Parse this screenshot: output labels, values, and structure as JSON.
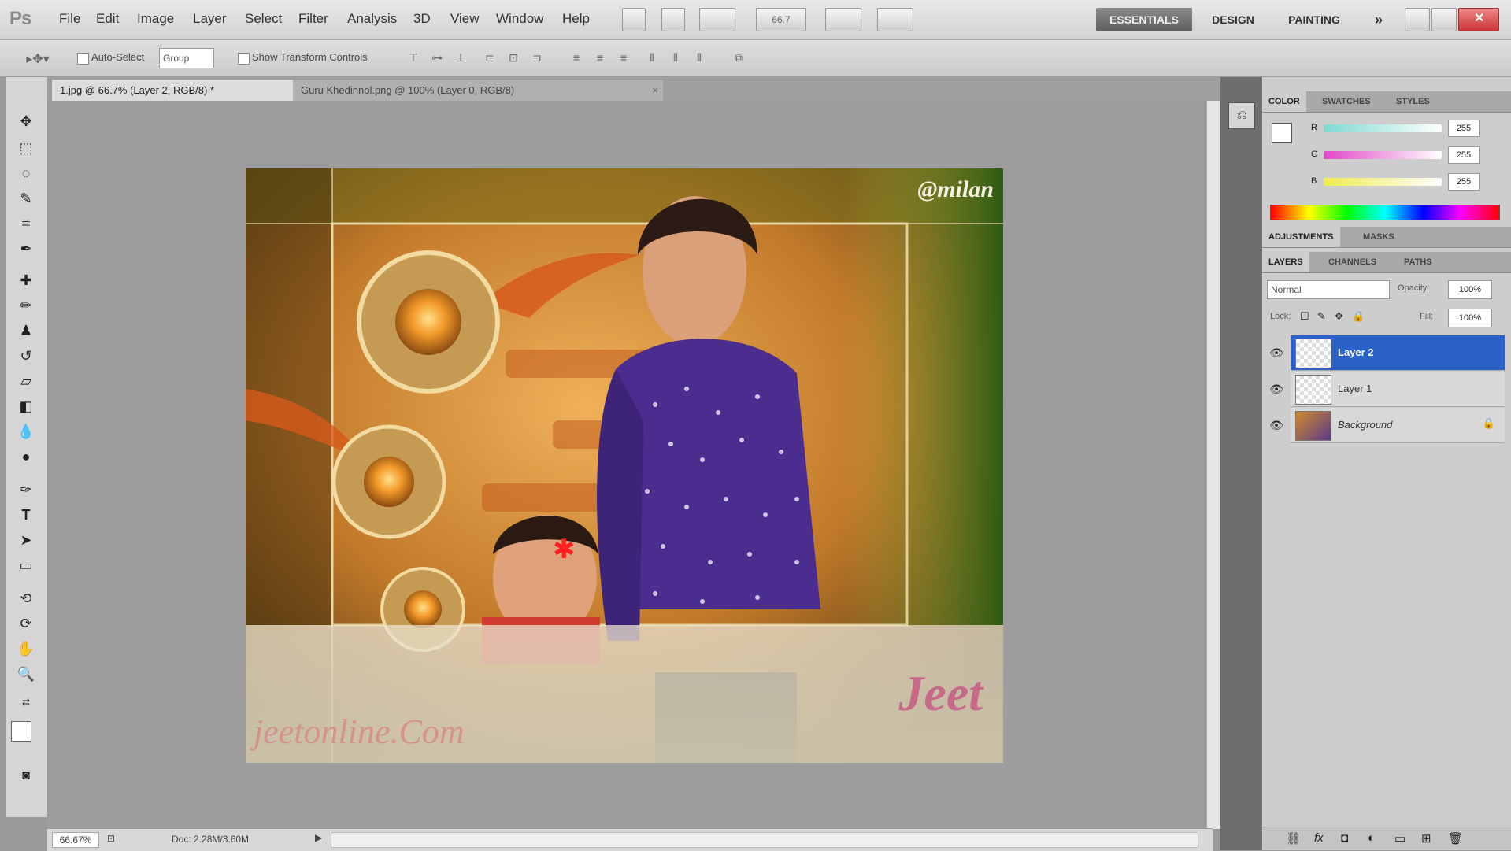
{
  "app": {
    "logo": "Ps",
    "menu": [
      "File",
      "Edit",
      "Image",
      "Layer",
      "Select",
      "Filter",
      "Analysis",
      "3D",
      "View",
      "Window",
      "Help"
    ],
    "zoom_field": "66.7",
    "workspaces": [
      "ESSENTIALS",
      "DESIGN",
      "PAINTING"
    ],
    "more_workspaces": "»"
  },
  "options": {
    "auto_select_label": "Auto-Select",
    "auto_select_value": "Group",
    "show_transform_label": "Show Transform Controls"
  },
  "tabs": [
    {
      "label": "1.jpg @ 66.7% (Layer 2, RGB/8) *"
    },
    {
      "label": "Guru Khedinnol.png @ 100% (Layer 0, RGB/8)"
    }
  ],
  "artwork": {
    "watermark": "@milan",
    "signature": "Jeet",
    "site_text": "jeetonline.Com"
  },
  "status": {
    "zoom": "66.67%",
    "doc": "Doc: 2.28M/3.60M"
  },
  "color_panel": {
    "tabs": [
      "COLOR",
      "SWATCHES",
      "STYLES"
    ],
    "channels": [
      {
        "name": "R",
        "value": "255"
      },
      {
        "name": "G",
        "value": "255"
      },
      {
        "name": "B",
        "value": "255"
      }
    ]
  },
  "adjust_panel": {
    "tabs": [
      "ADJUSTMENTS",
      "MASKS"
    ]
  },
  "layers_panel": {
    "tabs": [
      "LAYERS",
      "CHANNELS",
      "PATHS"
    ],
    "blend_mode": "Normal",
    "opacity_label": "Opacity:",
    "opacity_value": "100%",
    "lock_label": "Lock:",
    "fill_label": "Fill:",
    "fill_value": "100%",
    "layers": [
      {
        "name": "Layer 2"
      },
      {
        "name": "Layer 1"
      },
      {
        "name": "Background"
      }
    ]
  },
  "colors": {
    "selection": "#2a62c9",
    "shirt": "#4a2d8e"
  }
}
